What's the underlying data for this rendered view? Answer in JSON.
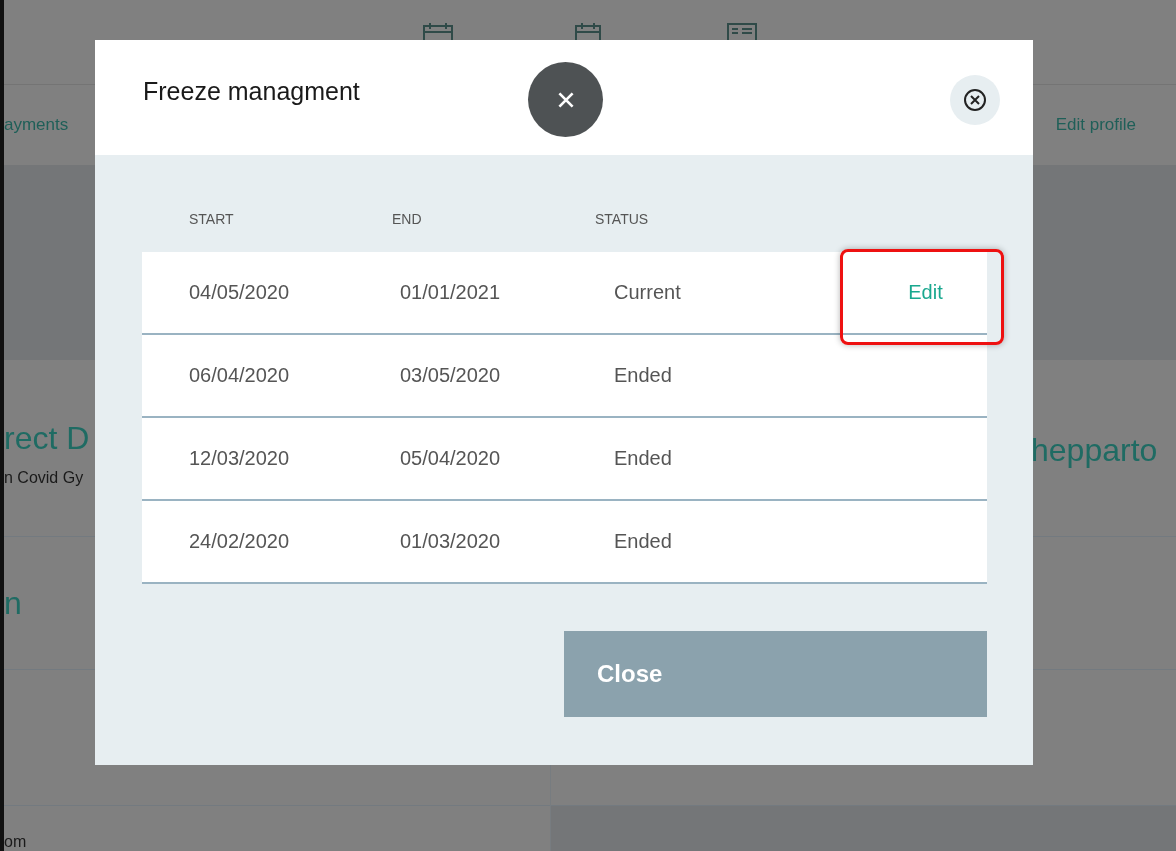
{
  "background": {
    "tabs_left": "ayments",
    "tabs_right": "Edit profile",
    "left_heading": "rect D",
    "left_subtitle": "n Covid Gy",
    "left_section": "n",
    "left_footer": "om",
    "right_heading": "hepparto"
  },
  "modal": {
    "title": "Freeze managment",
    "columns": [
      "START",
      "END",
      "STATUS"
    ],
    "rows": [
      {
        "start": "04/05/2020",
        "end": "01/01/2021",
        "status": "Current",
        "action": "Edit",
        "highlighted": true
      },
      {
        "start": "06/04/2020",
        "end": "03/05/2020",
        "status": "Ended",
        "highlighted": false
      },
      {
        "start": "12/03/2020",
        "end": "05/04/2020",
        "status": "Ended",
        "highlighted": false
      },
      {
        "start": "24/02/2020",
        "end": "01/03/2020",
        "status": "Ended",
        "highlighted": false
      }
    ],
    "close_button": "Close"
  }
}
